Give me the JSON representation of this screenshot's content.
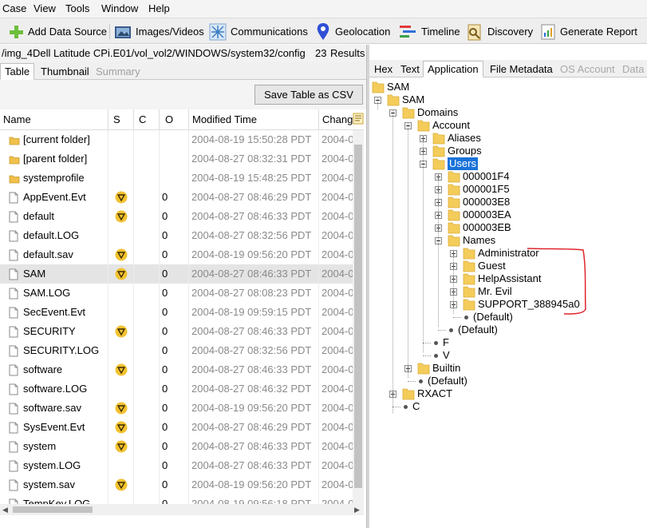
{
  "menu": {
    "case": "Case",
    "view": "View",
    "tools": "Tools",
    "window": "Window",
    "help": "Help"
  },
  "toolbar": {
    "add_data_source": "Add Data Source",
    "images_videos": "Images/Videos",
    "communications": "Communications",
    "geolocation": "Geolocation",
    "timeline": "Timeline",
    "discovery": "Discovery",
    "generate_report": "Generate Report"
  },
  "location": {
    "path": "/img_4Dell Latitude CPi.E01/vol_vol2/WINDOWS/system32/config",
    "count": "23",
    "results_label": "Results"
  },
  "left_tabs": {
    "table": "Table",
    "thumbnail": "Thumbnail",
    "summary": "Summary"
  },
  "save_csv": "Save Table as CSV",
  "columns": {
    "name": "Name",
    "s": "S",
    "c": "C",
    "o": "O",
    "modified": "Modified Time",
    "change": "Chang"
  },
  "rows": [
    {
      "name": "[current folder]",
      "o": "",
      "modified": "2004-08-19 15:50:28 PDT",
      "change": "2004-0"
    },
    {
      "name": "[parent folder]",
      "o": "",
      "modified": "2004-08-27 08:32:31 PDT",
      "change": "2004-0"
    },
    {
      "name": "systemprofile",
      "o": "",
      "modified": "2004-08-19 15:48:25 PDT",
      "change": "2004-0"
    },
    {
      "name": "AppEvent.Evt",
      "o": "0",
      "modified": "2004-08-27 08:46:29 PDT",
      "change": "2004-0"
    },
    {
      "name": "default",
      "o": "0",
      "modified": "2004-08-27 08:46:33 PDT",
      "change": "2004-0"
    },
    {
      "name": "default.LOG",
      "o": "0",
      "modified": "2004-08-27 08:32:56 PDT",
      "change": "2004-0"
    },
    {
      "name": "default.sav",
      "o": "0",
      "modified": "2004-08-19 09:56:20 PDT",
      "change": "2004-0"
    },
    {
      "name": "SAM",
      "o": "0",
      "modified": "2004-08-27 08:46:33 PDT",
      "change": "2004-0"
    },
    {
      "name": "SAM.LOG",
      "o": "0",
      "modified": "2004-08-27 08:08:23 PDT",
      "change": "2004-0"
    },
    {
      "name": "SecEvent.Evt",
      "o": "0",
      "modified": "2004-08-19 09:59:15 PDT",
      "change": "2004-0"
    },
    {
      "name": "SECURITY",
      "o": "0",
      "modified": "2004-08-27 08:46:33 PDT",
      "change": "2004-0"
    },
    {
      "name": "SECURITY.LOG",
      "o": "0",
      "modified": "2004-08-27 08:32:56 PDT",
      "change": "2004-0"
    },
    {
      "name": "software",
      "o": "0",
      "modified": "2004-08-27 08:46:33 PDT",
      "change": "2004-0"
    },
    {
      "name": "software.LOG",
      "o": "0",
      "modified": "2004-08-27 08:46:32 PDT",
      "change": "2004-0"
    },
    {
      "name": "software.sav",
      "o": "0",
      "modified": "2004-08-19 09:56:20 PDT",
      "change": "2004-0"
    },
    {
      "name": "SysEvent.Evt",
      "o": "0",
      "modified": "2004-08-27 08:46:29 PDT",
      "change": "2004-0"
    },
    {
      "name": "system",
      "o": "0",
      "modified": "2004-08-27 08:46:33 PDT",
      "change": "2004-0"
    },
    {
      "name": "system.LOG",
      "o": "0",
      "modified": "2004-08-27 08:46:33 PDT",
      "change": "2004-0"
    },
    {
      "name": "system.sav",
      "o": "0",
      "modified": "2004-08-19 09:56:20 PDT",
      "change": "2004-0"
    },
    {
      "name": "TempKey.LOG",
      "o": "0",
      "modified": "2004-08-19 09:56:18 PDT",
      "change": "2004-0"
    }
  ],
  "right_tabs": {
    "hex": "Hex",
    "text": "Text",
    "application": "Application",
    "file_metadata": "File Metadata",
    "os_account": "OS Account",
    "data": "Data"
  },
  "tree": {
    "sam_root": "SAM",
    "sam": "SAM",
    "domains": "Domains",
    "account": "Account",
    "aliases": "Aliases",
    "groups": "Groups",
    "users": "Users",
    "u1": "000001F4",
    "u2": "000001F5",
    "u3": "000003E8",
    "u4": "000003EA",
    "u5": "000003EB",
    "names": "Names",
    "administrator": "Administrator",
    "guest": "Guest",
    "helpassistant": "HelpAssistant",
    "mrevil": "Mr. Evil",
    "support": "SUPPORT_388945a0",
    "names_default": "(Default)",
    "users_default": "(Default)",
    "f": "F",
    "v": "V",
    "builtin": "Builtin",
    "domains_default": "(Default)",
    "rxact": "RXACT",
    "c": "C"
  },
  "colors": {
    "selection": "#1a73d9",
    "annotation": "#e0242b",
    "badge": "#f2c230",
    "folder": "#f4cc5a"
  }
}
